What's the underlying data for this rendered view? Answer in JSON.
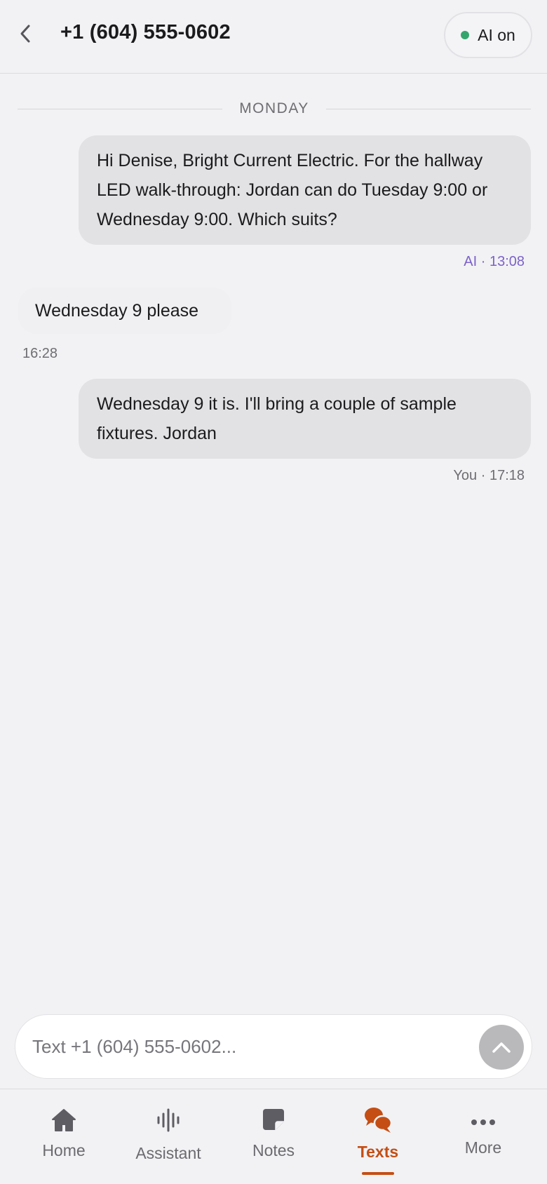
{
  "header": {
    "title": "+1 (604) 555-0602",
    "ai_toggle_label": "AI on"
  },
  "conversation": {
    "day_label": "MONDAY",
    "messages": [
      {
        "direction": "outgoing",
        "text": "Hi Denise, Bright Current Electric. For the hallway LED walk-through: Jordan can do Tuesday 9:00 or Wednesday 9:00. Which suits?",
        "meta": "AI · 13:08"
      },
      {
        "direction": "incoming",
        "text": "Wednesday 9 please",
        "meta": "16:28"
      },
      {
        "direction": "outgoing",
        "text": "Wednesday 9 it is. I'll bring a couple of sample fixtures. Jordan",
        "meta": "You · 17:18"
      }
    ]
  },
  "composer": {
    "placeholder": "Text +1 (604) 555-0602..."
  },
  "nav": {
    "items": [
      {
        "label": "Home",
        "icon": "home-icon"
      },
      {
        "label": "Assistant",
        "icon": "waveform-icon"
      },
      {
        "label": "Notes",
        "icon": "note-icon"
      },
      {
        "label": "Texts",
        "icon": "chat-bubbles-icon",
        "active": true
      },
      {
        "label": "More",
        "icon": "more-dots-icon"
      }
    ]
  },
  "colors": {
    "accent": "#c44e14",
    "ai_status": "#35a56e",
    "ai_meta": "#7c62c9",
    "bubble": "#e2e2e4"
  }
}
